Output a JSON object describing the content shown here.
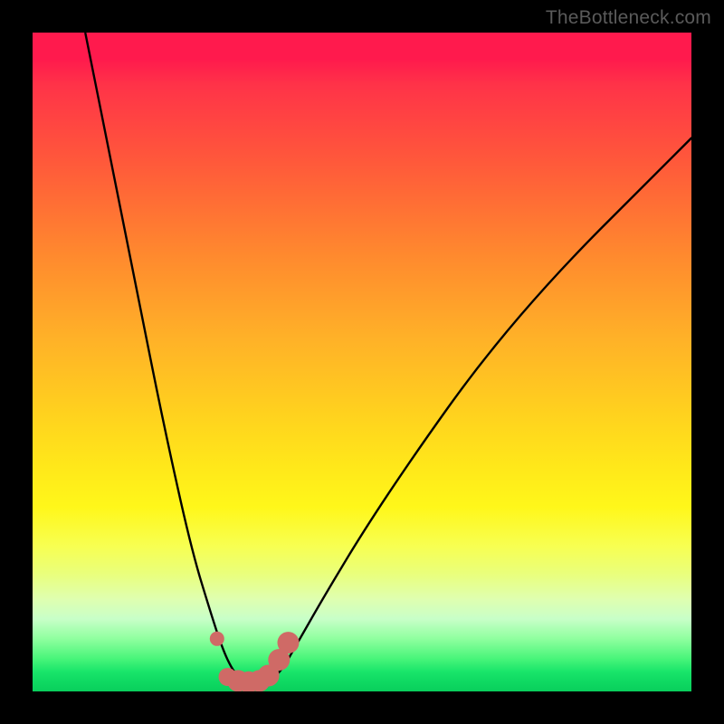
{
  "watermark": "TheBottleneck.com",
  "chart_data": {
    "type": "line",
    "title": "",
    "xlabel": "",
    "ylabel": "",
    "xlim": [
      0,
      100
    ],
    "ylim": [
      0,
      100
    ],
    "grid": false,
    "series": [
      {
        "name": "bottleneck-curve",
        "x": [
          8,
          12,
          16,
          20,
          24,
          27,
          29,
          30.5,
          32,
          33.5,
          35,
          36.5,
          38,
          40,
          44,
          50,
          58,
          68,
          80,
          94,
          100
        ],
        "y": [
          100,
          80,
          60,
          40,
          22,
          12,
          6,
          3,
          1.5,
          1,
          1,
          2,
          3.5,
          7,
          14,
          24,
          36,
          50,
          64,
          78,
          84
        ]
      }
    ],
    "markers": {
      "name": "highlight-points",
      "color": "#cf6a66",
      "points": [
        {
          "x": 28.0,
          "y": 8.0,
          "r": 8
        },
        {
          "x": 29.6,
          "y": 2.2,
          "r": 10
        },
        {
          "x": 31.2,
          "y": 1.6,
          "r": 12
        },
        {
          "x": 32.8,
          "y": 1.4,
          "r": 12
        },
        {
          "x": 34.4,
          "y": 1.6,
          "r": 12
        },
        {
          "x": 35.8,
          "y": 2.4,
          "r": 12
        },
        {
          "x": 37.4,
          "y": 4.8,
          "r": 12
        },
        {
          "x": 38.8,
          "y": 7.4,
          "r": 12
        }
      ]
    },
    "gradient_stops": [
      {
        "offset": 0.0,
        "color": "#ff1a4d"
      },
      {
        "offset": 0.2,
        "color": "#ff5a3a"
      },
      {
        "offset": 0.46,
        "color": "#ffb028"
      },
      {
        "offset": 0.72,
        "color": "#fff71a"
      },
      {
        "offset": 0.92,
        "color": "#8fff9f"
      },
      {
        "offset": 1.0,
        "color": "#09cf5c"
      }
    ]
  }
}
